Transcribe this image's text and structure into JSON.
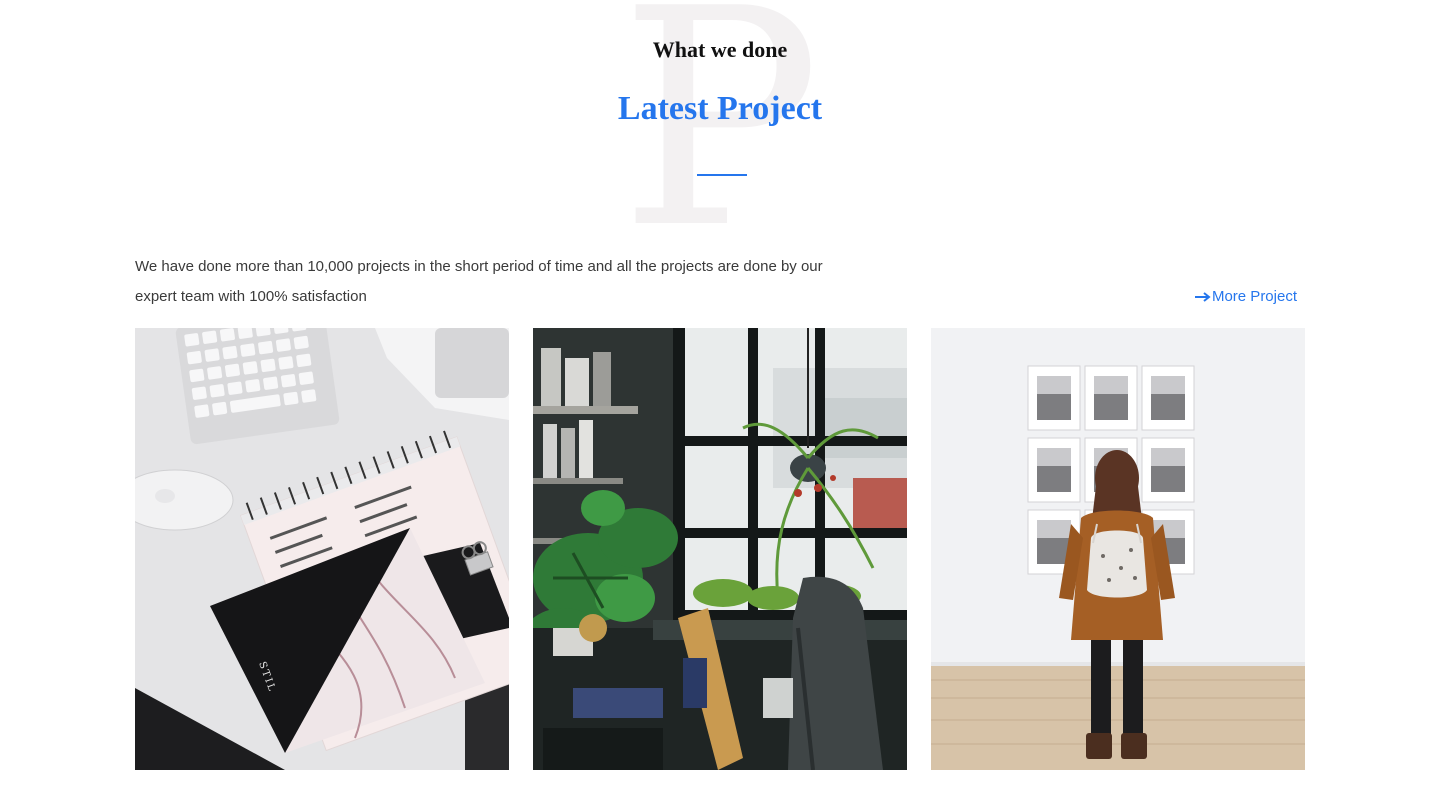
{
  "header": {
    "bg_letter": "P",
    "eyebrow": "What we done",
    "title": "Latest Project"
  },
  "intro": "We have done more than 10,000 projects in the short period of time and all the projects are done by our expert team with 100% satisfaction",
  "more_link": {
    "label": "More Project",
    "icon": "arrow-right-icon"
  },
  "projects": [
    {
      "name": "desk-notebook-photo",
      "alt": "Desk with keyboard, mouse and marble notebook",
      "notebook_text": "STIL"
    },
    {
      "name": "plants-window-photo",
      "alt": "Office window with hanging plants"
    },
    {
      "name": "gallery-woman-photo",
      "alt": "Woman viewing framed photographs in a gallery"
    }
  ],
  "colors": {
    "accent": "#2576ed",
    "heading": "#111111",
    "body_text": "#3a3a3a",
    "bg_letter": "#f3f1f2"
  }
}
